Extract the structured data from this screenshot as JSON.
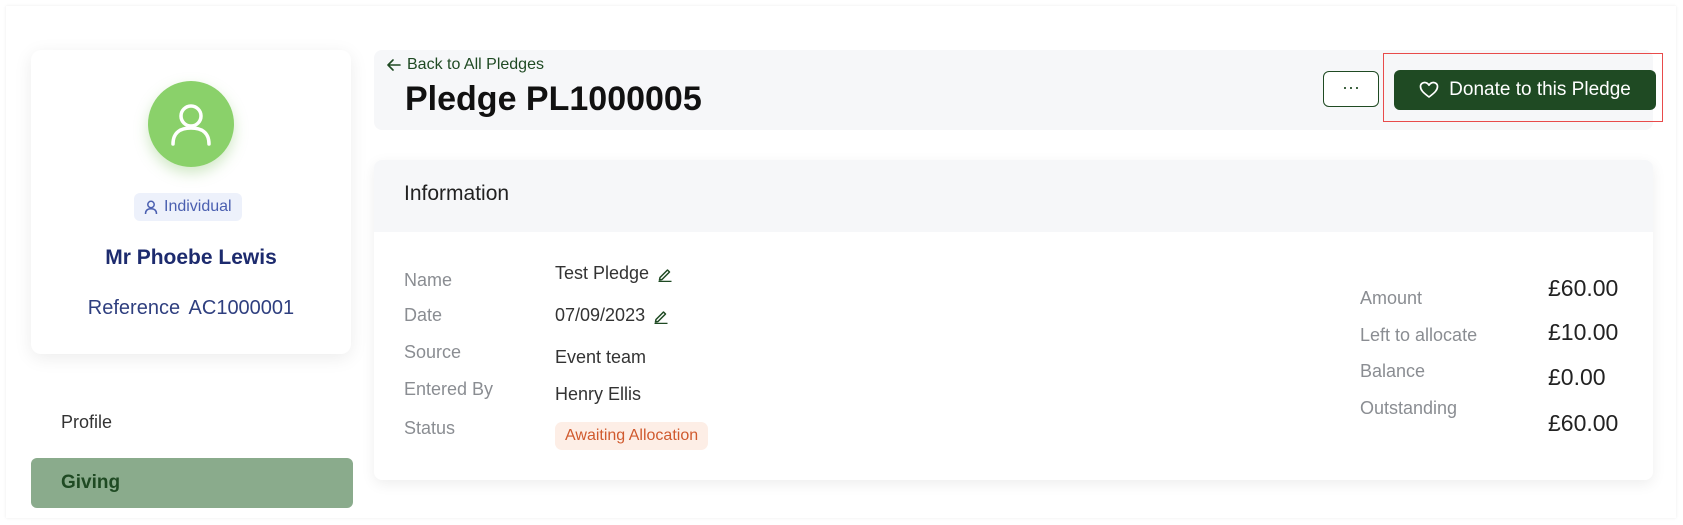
{
  "profile": {
    "type_label": "Individual",
    "name": "Mr Phoebe Lewis",
    "reference_label": "Reference",
    "reference_value": "AC1000001"
  },
  "nav": {
    "items": [
      {
        "label": "Profile"
      },
      {
        "label": "Giving"
      }
    ]
  },
  "header": {
    "back_label": "Back to All Pledges",
    "title": "Pledge PL1000005",
    "more_label": "···",
    "donate_label": "Donate to this Pledge"
  },
  "info": {
    "title": "Information",
    "fields": {
      "name_label": "Name",
      "name_value": "Test Pledge",
      "date_label": "Date",
      "date_value": "07/09/2023",
      "source_label": "Source",
      "source_value": "Event team",
      "entered_label": "Entered By",
      "entered_value": "Henry Ellis",
      "status_label": "Status",
      "status_value": "Awaiting Allocation"
    },
    "summary": {
      "amount_label": "Amount",
      "amount_value": "£60.00",
      "left_label": "Left to allocate",
      "left_value": "£10.00",
      "balance_label": "Balance",
      "balance_value": "£0.00",
      "outstanding_label": "Outstanding",
      "outstanding_value": "£60.00"
    }
  },
  "colors": {
    "primary": "#1f4a23",
    "avatar": "#8ad16a",
    "giving_bg": "#8aab8c",
    "status_text": "#d05a2e",
    "highlight": "#e84b4b"
  },
  "icons": [
    "user-icon",
    "person-outline-icon",
    "arrow-left-icon",
    "pencil-icon",
    "heart-icon"
  ]
}
